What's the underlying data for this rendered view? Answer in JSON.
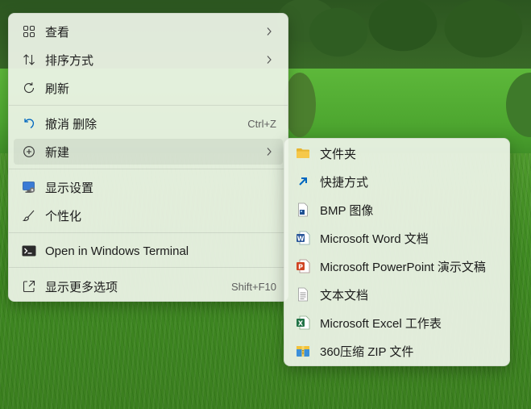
{
  "context_menu": {
    "items": [
      {
        "label": "查看",
        "icon": "grid-icon",
        "submenu": true
      },
      {
        "label": "排序方式",
        "icon": "sort-icon",
        "submenu": true
      },
      {
        "label": "刷新",
        "icon": "refresh-icon"
      },
      {
        "label": "撤消 删除",
        "icon": "undo-icon",
        "shortcut": "Ctrl+Z"
      },
      {
        "label": "新建",
        "icon": "add-circle-icon",
        "submenu": true,
        "highlighted": true
      },
      {
        "label": "显示设置",
        "icon": "display-settings-icon"
      },
      {
        "label": "个性化",
        "icon": "brush-icon"
      },
      {
        "label": "Open in Windows Terminal",
        "icon": "terminal-icon"
      },
      {
        "label": "显示更多选项",
        "icon": "more-options-icon",
        "shortcut": "Shift+F10"
      }
    ]
  },
  "new_submenu": {
    "items": [
      {
        "label": "文件夹",
        "icon": "folder-icon"
      },
      {
        "label": "快捷方式",
        "icon": "shortcut-icon"
      },
      {
        "label": "BMP 图像",
        "icon": "bmp-image-icon"
      },
      {
        "label": "Microsoft Word 文档",
        "icon": "word-icon"
      },
      {
        "label": "Microsoft PowerPoint 演示文稿",
        "icon": "powerpoint-icon"
      },
      {
        "label": "文本文档",
        "icon": "text-document-icon"
      },
      {
        "label": "Microsoft Excel 工作表",
        "icon": "excel-icon"
      },
      {
        "label": "360压缩 ZIP 文件",
        "icon": "zip-icon"
      }
    ]
  },
  "colors": {
    "word": "#2b579a",
    "powerpoint": "#d04423",
    "excel": "#217346",
    "folder": "#f4c542",
    "accent": "#0067c0"
  }
}
